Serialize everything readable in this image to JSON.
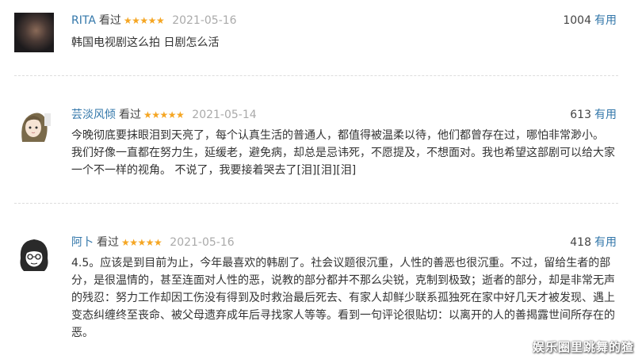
{
  "reviews": [
    {
      "user": "RITA",
      "seen_label": "看过",
      "stars": "★★★★★",
      "date": "2021-05-16",
      "helpful_count": "1004",
      "helpful_label": "有用",
      "content": "韩国电视剧这么拍 日剧怎么活"
    },
    {
      "user": "芸淡风倾",
      "seen_label": "看过",
      "stars": "★★★★★",
      "date": "2021-05-14",
      "helpful_count": "613",
      "helpful_label": "有用",
      "content": "今晚彻底要抹眼泪到天亮了，每个认真生活的普通人，都值得被温柔以待，他们都曾存在过，哪怕非常渺小。 我们好像一直都在努力生，延缓老，避免病，却总是忌讳死，不愿提及，不想面对。我也希望这部剧可以给大家一个不一样的视角。 不说了，我要接着哭去了[泪][泪][泪]"
    },
    {
      "user": "阿卜",
      "seen_label": "看过",
      "stars": "★★★★★",
      "date": "2021-05-16",
      "helpful_count": "418",
      "helpful_label": "有用",
      "content": "4.5。应该是到目前为止，今年最喜欢的韩剧了。社会议题很沉重，人性的善恶也很沉重。不过，留给生者的部分，是很温情的，甚至连面对人性的恶，说教的部分都并不那么尖锐，克制到极致；逝者的部分，却是非常无声的残忍：努力工作却因工伤没有得到及时救治最后死去、有家人却鲜少联系孤独死在家中好几天才被发现、遇上变态纠缠终至丧命、被父母遗弃成年后寻找家人等等。看到一句评论很贴切：以离开的人的善揭露世间所存在的恶。"
    }
  ],
  "watermark": "娱乐圈里跳舞的猹",
  "colors": {
    "username": "#3377aa",
    "star": "#f5a623",
    "date": "#aaaaaa",
    "useful": "#3377aa"
  }
}
